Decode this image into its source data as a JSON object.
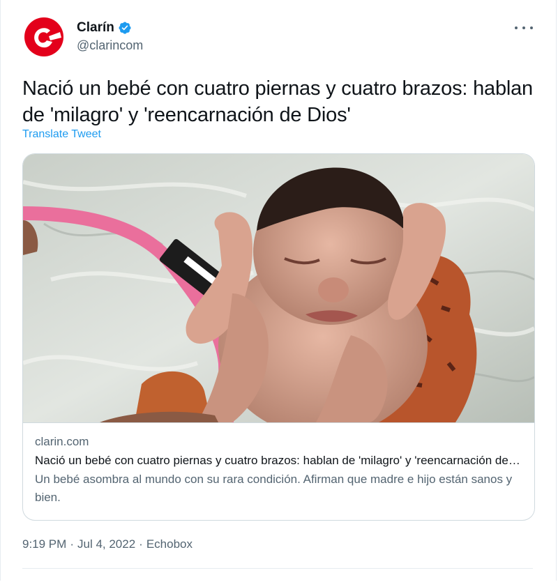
{
  "tweet": {
    "author": {
      "display_name": "Clarín",
      "handle": "@clarincom",
      "avatar_icon": "clarin-logo",
      "verified_icon": "verified-badge-icon",
      "brand_color": "#e3001b",
      "verified_color": "#1d9bf0"
    },
    "more_icon": "more-options-icon",
    "text": "Nació un bebé con cuatro piernas y cuatro brazos: hablan de 'milagro' y 'reencarnación de Dios'",
    "translate_label": "Translate Tweet",
    "card": {
      "image_icon": "newborn-photo",
      "domain": "clarin.com",
      "title": "Nació un bebé con cuatro piernas y cuatro brazos: hablan de 'milagro' y 'reencarnación de Dios'",
      "description": "Un bebé asombra al mundo con su rara condición. Afirman que madre e hijo están sanos y bien."
    },
    "time": "9:19 PM",
    "date": "Jul 4, 2022",
    "source": "Echobox",
    "separator": "·"
  }
}
